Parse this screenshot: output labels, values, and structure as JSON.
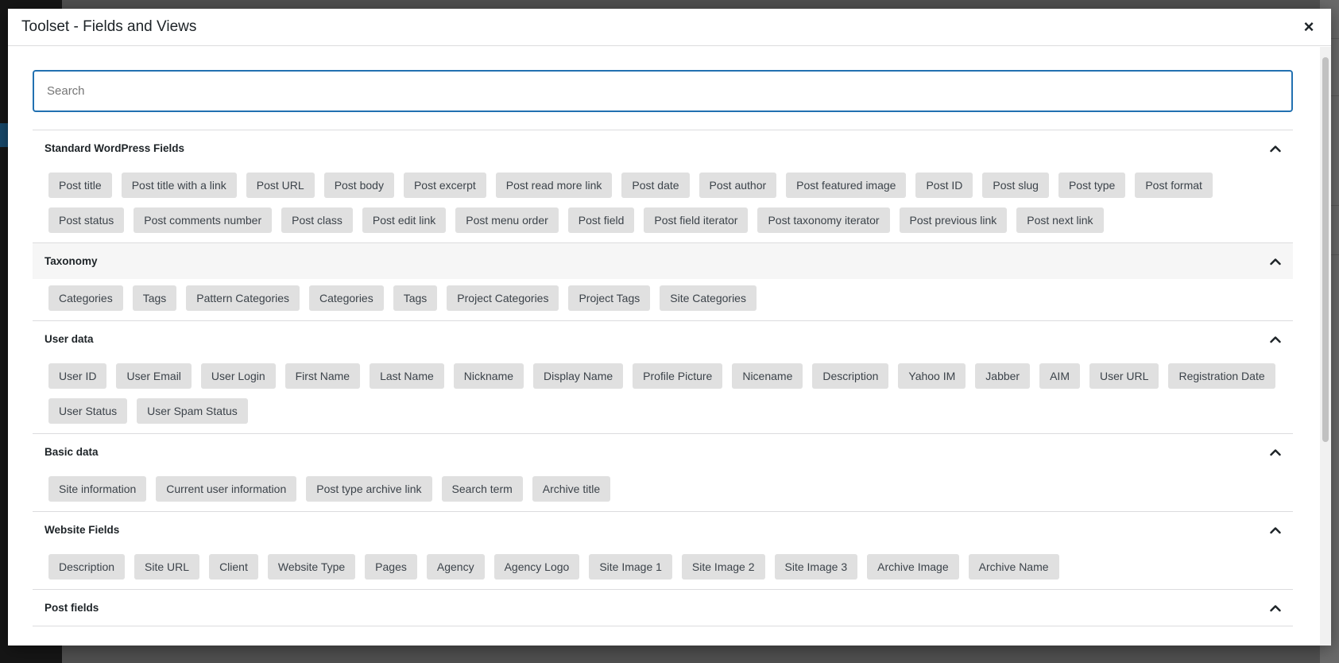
{
  "dialog": {
    "title": "Toolset - Fields and Views",
    "close_label": "×"
  },
  "search": {
    "placeholder": "Search",
    "value": ""
  },
  "sections": [
    {
      "title": "Standard WordPress Fields",
      "items": [
        "Post title",
        "Post title with a link",
        "Post URL",
        "Post body",
        "Post excerpt",
        "Post read more link",
        "Post date",
        "Post author",
        "Post featured image",
        "Post ID",
        "Post slug",
        "Post type",
        "Post format",
        "Post status",
        "Post comments number",
        "Post class",
        "Post edit link",
        "Post menu order",
        "Post field",
        "Post field iterator",
        "Post taxonomy iterator",
        "Post previous link",
        "Post next link"
      ]
    },
    {
      "title": "Taxonomy",
      "items": [
        "Categories",
        "Tags",
        "Pattern Categories",
        "Categories",
        "Tags",
        "Project Categories",
        "Project Tags",
        "Site Categories"
      ]
    },
    {
      "title": "User data",
      "items": [
        "User ID",
        "User Email",
        "User Login",
        "First Name",
        "Last Name",
        "Nickname",
        "Display Name",
        "Profile Picture",
        "Nicename",
        "Description",
        "Yahoo IM",
        "Jabber",
        "AIM",
        "User URL",
        "Registration Date",
        "User Status",
        "User Spam Status"
      ]
    },
    {
      "title": "Basic data",
      "items": [
        "Site information",
        "Current user information",
        "Post type archive link",
        "Search term",
        "Archive title"
      ]
    },
    {
      "title": "Website Fields",
      "items": [
        "Description",
        "Site URL",
        "Client",
        "Website Type",
        "Pages",
        "Agency",
        "Agency Logo",
        "Site Image 1",
        "Site Image 2",
        "Site Image 3",
        "Archive Image",
        "Archive Name"
      ]
    },
    {
      "title": "Post fields",
      "items": []
    }
  ],
  "icons": {
    "close": "close-icon",
    "collapse": "chevron-up-icon"
  },
  "colors": {
    "accent": "#2271b1",
    "chip_bg": "#e0e0e0",
    "overlay": "#505050"
  }
}
